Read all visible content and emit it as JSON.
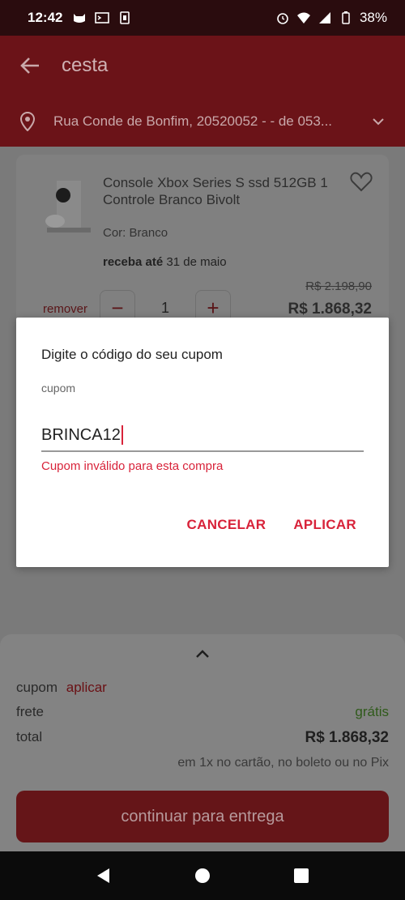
{
  "status_bar": {
    "time": "12:42",
    "battery": "38%"
  },
  "header": {
    "title": "cesta",
    "address": "Rua Conde de Bonfim, 20520052 - - de 053..."
  },
  "product": {
    "name": "Console Xbox Series S ssd 512GB 1 Controle Branco Bivolt",
    "color": "Cor: Branco",
    "delivery_label": "receba até",
    "delivery_date": "31 de maio",
    "remove_label": "remover",
    "quantity": "1",
    "minus": "−",
    "plus": "+",
    "old_price": "R$ 2.198,90",
    "price": "R$ 1.868,32"
  },
  "summary": {
    "coupon_label": "cupom",
    "coupon_apply": "aplicar",
    "shipping_label": "frete",
    "shipping_value": "grátis",
    "total_label": "total",
    "total_value": "R$ 1.868,32",
    "installments": "em 1x no cartão, no boleto ou no Pix",
    "continue_button": "continuar para entrega"
  },
  "dialog": {
    "title": "Digite o código do seu cupom",
    "field_label": "cupom",
    "field_value": "BRINCA12",
    "error": "Cupom inválido para esta compra",
    "cancel": "CANCELAR",
    "apply": "APLICAR"
  },
  "colors": {
    "brand": "#d8233a",
    "header_dimmed": "#6b1318",
    "success": "#2f5a1a"
  },
  "icons": [
    "back-arrow-icon",
    "location-pin-icon",
    "chevron-down-icon",
    "heart-icon",
    "chevron-up-icon",
    "nav-back-icon",
    "nav-home-icon",
    "nav-recents-icon"
  ]
}
